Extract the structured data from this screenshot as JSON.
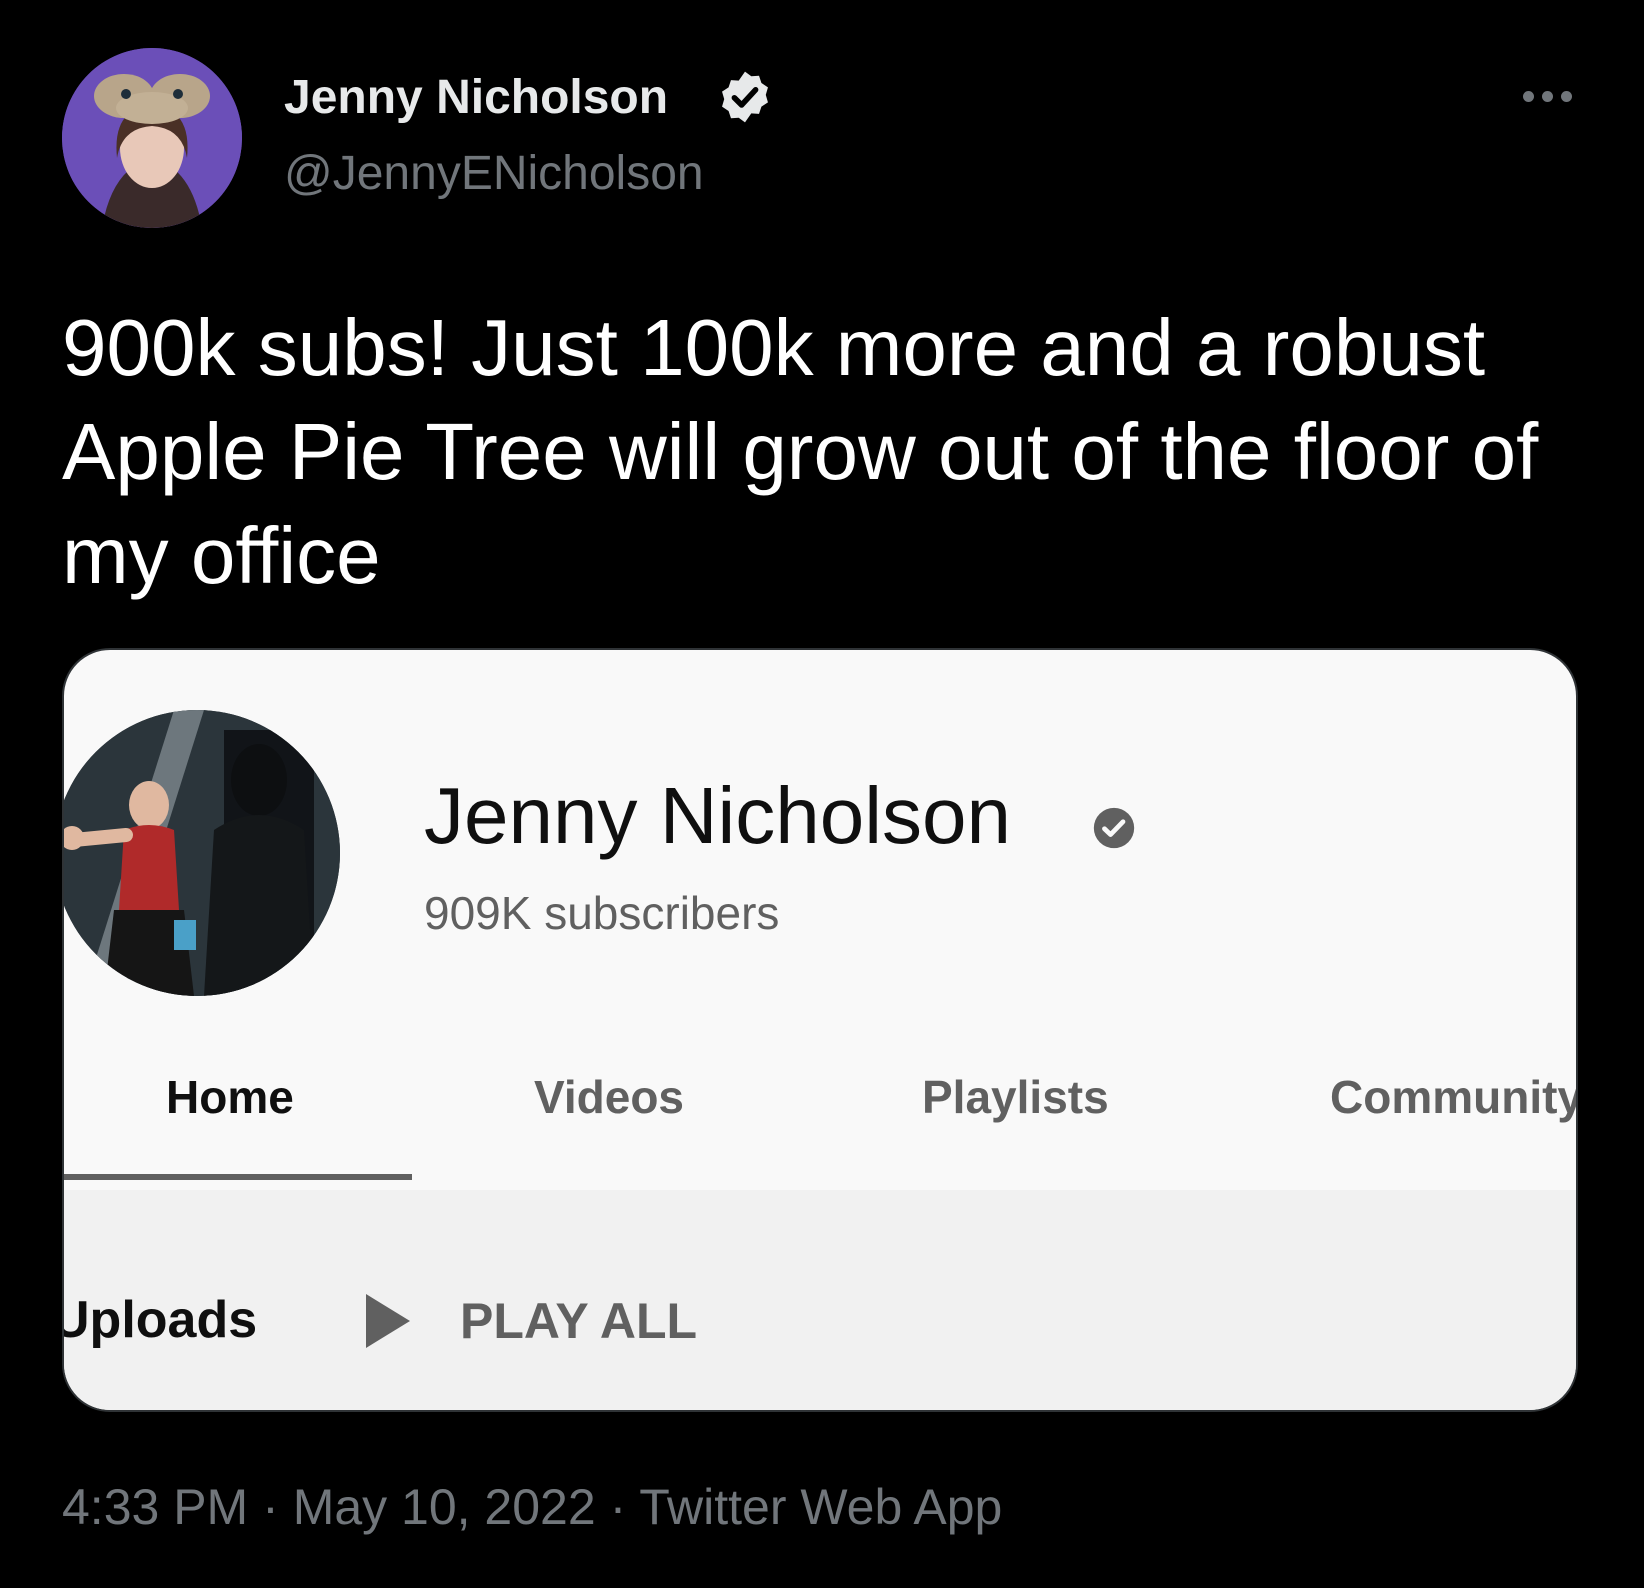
{
  "tweet": {
    "author": {
      "name": "Jenny Nicholson",
      "handle": "@JennyENicholson",
      "verified": true
    },
    "text": "900k subs! Just 100k more and a robust Apple Pie Tree will grow out of the floor of my office",
    "meta": {
      "time": "4:33 PM",
      "separator": "·",
      "date": "May 10, 2022",
      "source": "Twitter Web App"
    }
  },
  "embedded_screenshot": {
    "channel_name": "Jenny Nicholson",
    "subscribers": "909K subscribers",
    "tabs": [
      {
        "label": "Home",
        "active": true
      },
      {
        "label": "Videos",
        "active": false
      },
      {
        "label": "Playlists",
        "active": false
      },
      {
        "label": "Community",
        "active": false
      }
    ],
    "section_title": "Uploads",
    "play_all_label": "PLAY ALL"
  },
  "colors": {
    "background": "#000000",
    "text_primary": "#e7e9ea",
    "text_secondary": "#71767b",
    "card_background": "#f9f9f9",
    "youtube_text": "#0f0f0f",
    "youtube_muted": "#606060"
  },
  "icons": [
    "verified-badge-icon",
    "more-options-icon",
    "channel-verified-icon",
    "play-icon"
  ]
}
